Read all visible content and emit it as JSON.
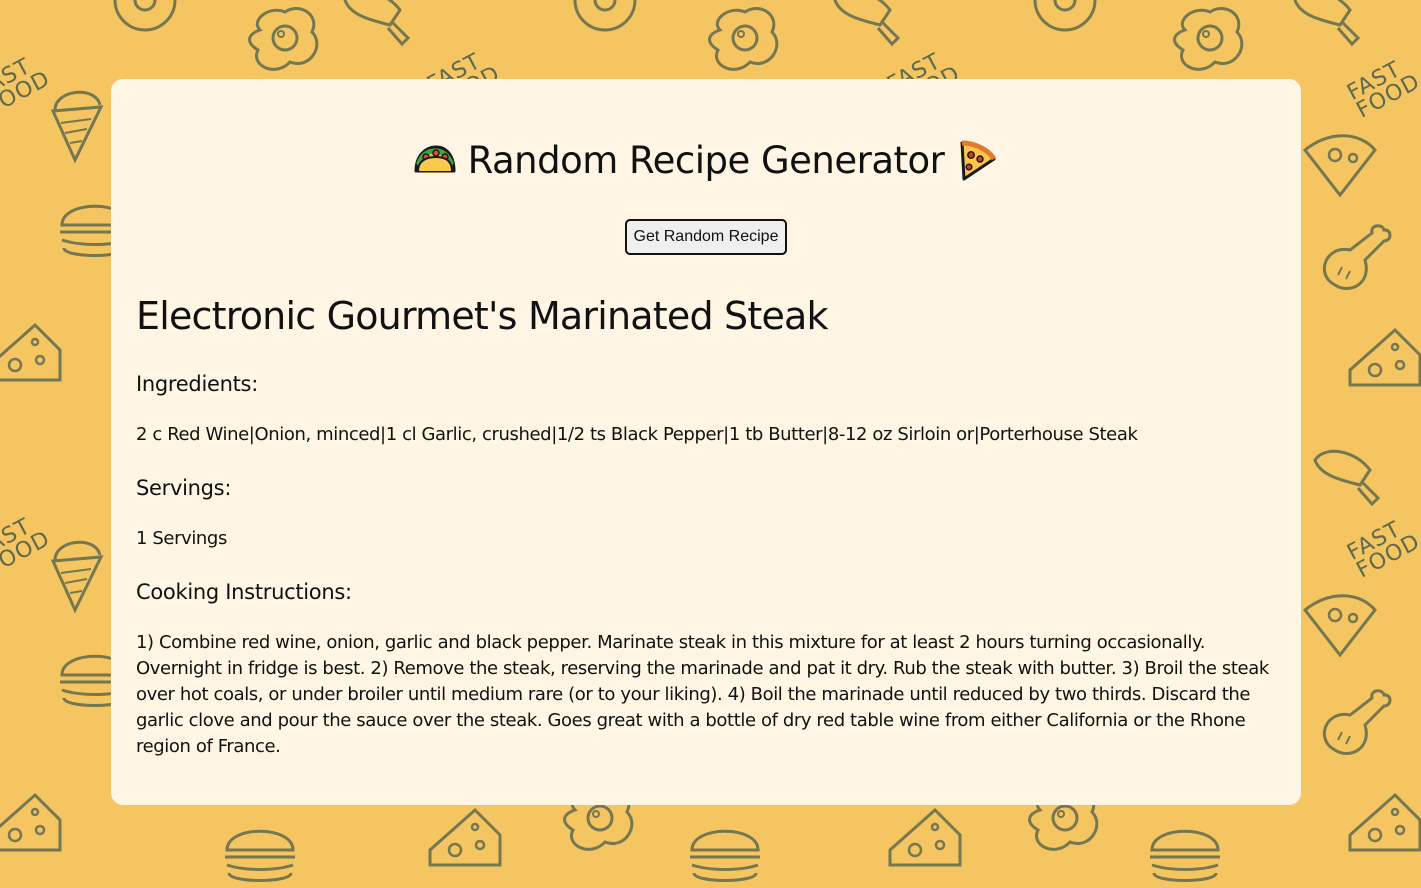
{
  "header": {
    "title": "Random Recipe Generator",
    "left_emoji": "taco-icon",
    "right_emoji": "pizza-icon"
  },
  "controls": {
    "random_button_label": "Get Random Recipe"
  },
  "recipe": {
    "name": "Electronic Gourmet's Marinated Steak",
    "ingredients_heading": "Ingredients:",
    "ingredients": "2 c Red Wine|Onion, minced|1 cl Garlic, crushed|1/2 ts Black Pepper|1 tb Butter|8-12 oz Sirloin or|Porterhouse Steak",
    "servings_heading": "Servings:",
    "servings": "1 Servings",
    "instructions_heading": "Cooking Instructions:",
    "instructions": "1) Combine red wine, onion, garlic and black pepper. Marinate steak in this mixture for at least 2 hours turning occasionally. Overnight in fridge is best. 2) Remove the steak, reserving the marinade and pat it dry. Rub the steak with butter. 3) Broil the steak over hot coals, or under broiler until medium rare (or to your liking). 4) Boil the marinade until reduced by two thirds. Discard the garlic clove and pour the sauce over the steak. Goes great with a bottle of dry red table wine from either California or the Rhone region of France."
  },
  "background": {
    "doodle_text": "FAST\nFOOD",
    "colors": {
      "page": "#f5c562",
      "card": "#fef5e4",
      "doodle_stroke": "#5e6a4d"
    }
  }
}
